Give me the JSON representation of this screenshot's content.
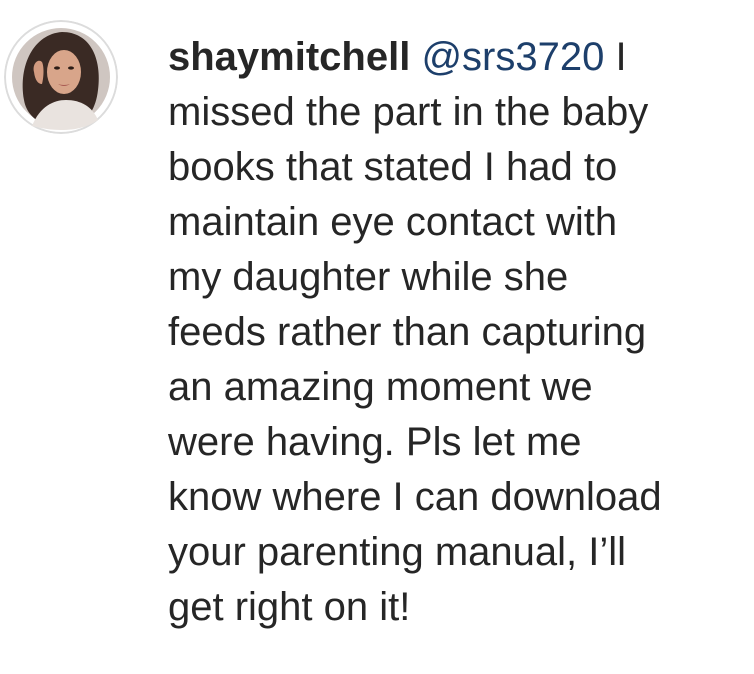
{
  "comment": {
    "username": "shaymitchell",
    "mention": "@srs3720",
    "text_lines": [
      "I",
      "missed the part in the baby",
      "books that stated I had to",
      "maintain eye contact with",
      "my daughter while she",
      "feeds rather than capturing",
      "an amazing moment we",
      "were having. Pls let me",
      "know where I can download",
      "your parenting manual, I’ll",
      "get right on it!"
    ]
  },
  "colors": {
    "text": "#262626",
    "mention": "#1d3f6b",
    "avatar_ring": "#e0e0e0"
  },
  "icons": {
    "avatar": "profile-photo"
  }
}
